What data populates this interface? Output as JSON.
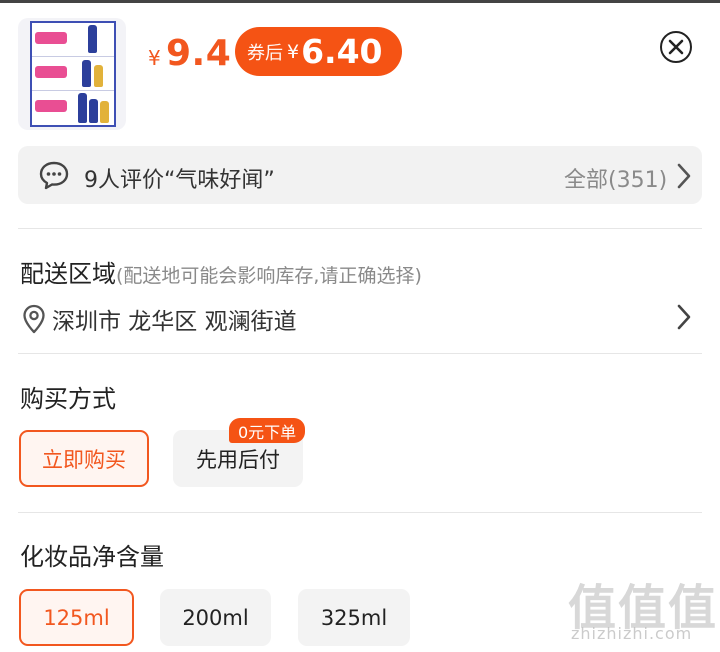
{
  "price": {
    "currency": "¥",
    "current": "9.4",
    "coupon_label": "券后",
    "coupon_currency": "¥",
    "coupon_price": "6.40"
  },
  "reviews": {
    "summary": "9人评价“气味好闻”",
    "all_label": "全部(351)"
  },
  "delivery": {
    "title": "配送区域",
    "hint": "(配送地可能会影响库存,请正确选择)",
    "location": "深圳市 龙华区 观澜街道"
  },
  "purchase": {
    "title": "购买方式",
    "options": [
      {
        "label": "立即购买",
        "selected": true
      },
      {
        "label": "先用后付",
        "selected": false,
        "badge": "0元下单"
      }
    ]
  },
  "volume": {
    "title": "化妆品净含量",
    "options": [
      {
        "label": "125ml",
        "selected": true
      },
      {
        "label": "200ml",
        "selected": false
      },
      {
        "label": "325ml",
        "selected": false
      }
    ]
  },
  "watermark": {
    "logo": "值值值",
    "site": "zhizhizhi.com"
  },
  "colors": {
    "accent": "#f55314",
    "price": "#f2571f"
  }
}
